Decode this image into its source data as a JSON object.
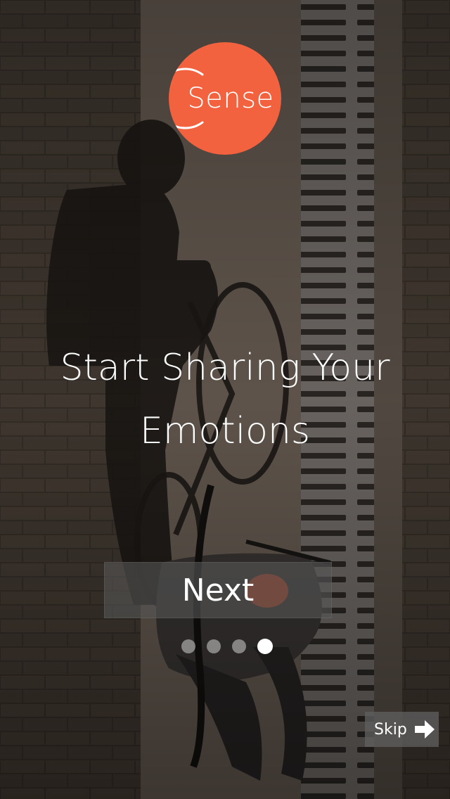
{
  "logo": {
    "text": "Sense",
    "background_color": "#f2623f"
  },
  "headline": {
    "line1": "Start Sharing Your",
    "line2": "Emotions"
  },
  "next_button": {
    "label": "Next"
  },
  "pager": {
    "total": 4,
    "active_index": 3
  },
  "skip_button": {
    "label": "Skip",
    "icon": "arrow-right-icon"
  }
}
